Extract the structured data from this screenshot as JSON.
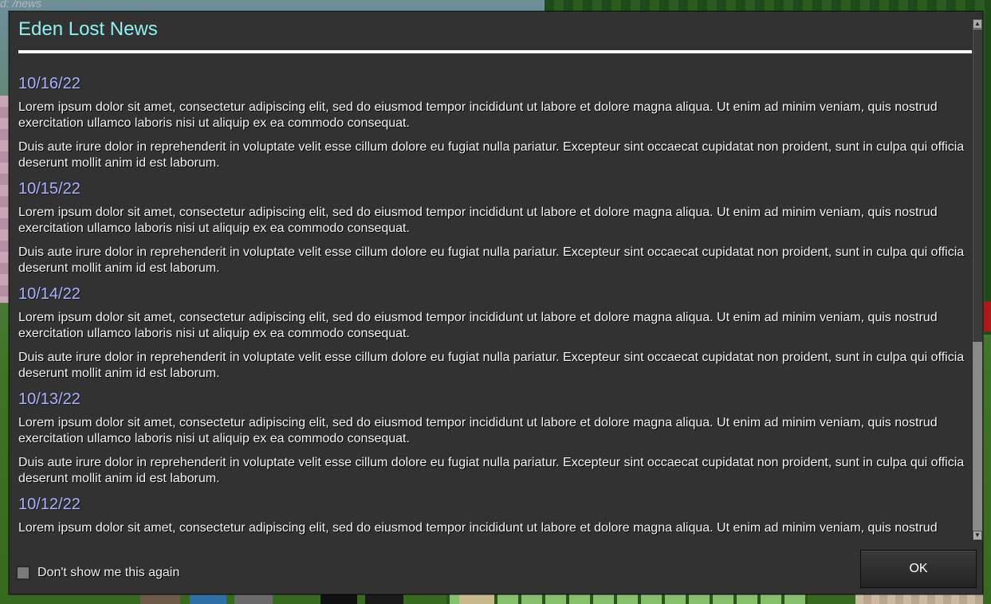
{
  "background": {
    "command_text": "d: /news"
  },
  "dialog": {
    "title": "Eden Lost News",
    "entries": [
      {
        "date": "10/16/22",
        "paragraphs": [
          "Lorem ipsum dolor sit amet, consectetur adipiscing elit, sed do eiusmod tempor incididunt ut labore et dolore magna aliqua. Ut enim ad minim veniam, quis nostrud exercitation ullamco laboris nisi ut aliquip ex ea commodo consequat.",
          "Duis aute irure dolor in reprehenderit in voluptate velit esse cillum dolore eu fugiat nulla pariatur. Excepteur sint occaecat cupidatat non proident, sunt in culpa qui officia deserunt mollit anim id est laborum."
        ]
      },
      {
        "date": "10/15/22",
        "paragraphs": [
          "Lorem ipsum dolor sit amet, consectetur adipiscing elit, sed do eiusmod tempor incididunt ut labore et dolore magna aliqua. Ut enim ad minim veniam, quis nostrud exercitation ullamco laboris nisi ut aliquip ex ea commodo consequat.",
          "Duis aute irure dolor in reprehenderit in voluptate velit esse cillum dolore eu fugiat nulla pariatur. Excepteur sint occaecat cupidatat non proident, sunt in culpa qui officia deserunt mollit anim id est laborum."
        ]
      },
      {
        "date": "10/14/22",
        "paragraphs": [
          "Lorem ipsum dolor sit amet, consectetur adipiscing elit, sed do eiusmod tempor incididunt ut labore et dolore magna aliqua. Ut enim ad minim veniam, quis nostrud exercitation ullamco laboris nisi ut aliquip ex ea commodo consequat.",
          "Duis aute irure dolor in reprehenderit in voluptate velit esse cillum dolore eu fugiat nulla pariatur. Excepteur sint occaecat cupidatat non proident, sunt in culpa qui officia deserunt mollit anim id est laborum."
        ]
      },
      {
        "date": "10/13/22",
        "paragraphs": [
          "Lorem ipsum dolor sit amet, consectetur adipiscing elit, sed do eiusmod tempor incididunt ut labore et dolore magna aliqua. Ut enim ad minim veniam, quis nostrud exercitation ullamco laboris nisi ut aliquip ex ea commodo consequat.",
          "Duis aute irure dolor in reprehenderit in voluptate velit esse cillum dolore eu fugiat nulla pariatur. Excepteur sint occaecat cupidatat non proident, sunt in culpa qui officia deserunt mollit anim id est laborum."
        ]
      },
      {
        "date": "10/12/22",
        "paragraphs": [
          "Lorem ipsum dolor sit amet, consectetur adipiscing elit, sed do eiusmod tempor incididunt ut labore et dolore magna aliqua. Ut enim ad minim veniam, quis nostrud"
        ]
      }
    ],
    "footer": {
      "checkbox_label": "Don't show me this again",
      "checkbox_checked": false,
      "ok_label": "OK"
    },
    "colors": {
      "title": "#8ff0f0",
      "date": "#aab0ff",
      "panel": "#323232"
    }
  }
}
